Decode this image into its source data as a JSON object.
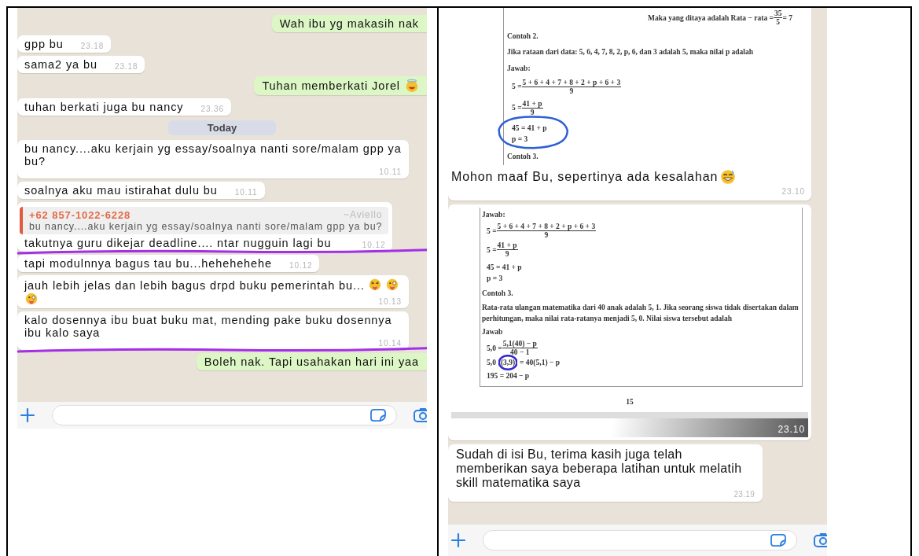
{
  "chats": [
    {
      "messages": [
        {
          "kind": "out",
          "text": "Wah ibu yg makasih nak"
        },
        {
          "kind": "in",
          "text": "gpp bu",
          "time": "23.18",
          "underlined": false
        },
        {
          "kind": "in",
          "text": "sama2 ya bu",
          "time": "23.18",
          "underlined": false
        },
        {
          "kind": "out",
          "text": "Tuhan memberkati Jorel",
          "emoji": [
            {
              "kind": "angel"
            }
          ]
        },
        {
          "kind": "in",
          "text": "tuhan berkati juga bu nancy",
          "time": "23.36",
          "underlined": false
        },
        {
          "kind": "date",
          "text": "Today"
        },
        {
          "kind": "in",
          "text": "bu nancy....aku kerjain yg essay/soalnya nanti sore/malam gpp ya bu?",
          "time": "10.11",
          "underlined": false
        },
        {
          "kind": "in",
          "text": "soalnya aku mau istirahat dulu bu",
          "time": "10.11",
          "underlined": false
        },
        {
          "kind": "quote",
          "quote": {
            "name": "+62 857-1022-6228",
            "author": "~Aviello",
            "text": "bu nancy....aku kerjain yg essay/soalnya nanti sore/malam gpp ya bu?"
          },
          "text": "takutnya guru dikejar deadline.... ntar nugguin lagi bu",
          "time": "10.12",
          "underlined": true
        },
        {
          "kind": "in",
          "text": "tapi modulnnya bagus tau bu...hehehehehe",
          "time": "10.12",
          "underlined": false
        },
        {
          "kind": "in",
          "text": "jauh lebih jelas dan lebih bagus drpd buku pemerintah bu...",
          "emoji": [
            {
              "kind": "tongue"
            },
            {
              "kind": "wink"
            },
            {
              "kind": "wink"
            }
          ],
          "time": "10.13",
          "underlined": false
        },
        {
          "kind": "in",
          "text": "kalo dosennya ibu buat buku mat, mending pake buku dosennya ibu kalo saya",
          "time": "10.14",
          "underlined": true
        },
        {
          "kind": "out",
          "text": "Boleh nak. Tapi usahakan hari ini yaa"
        }
      ]
    },
    {
      "messages": [
        {
          "kind": "image",
          "doc": {
            "kind": "ruled",
            "lines": [
              {
                "kind": "frac-right",
                "lhs": "Maka yang ditaya adalah Rata − rata = ",
                "num": "35",
                "den": "5",
                "rhs": " = 7"
              },
              {
                "kind": "text",
                "text": "Contoh 2."
              },
              {
                "kind": "text",
                "text": "Jika rataan dari data: 5, 6, 4, 7, 8, 2, p, 6, dan 3 adalah 5, maka nilai p adalah"
              },
              {
                "kind": "text",
                "text": "Jawab:"
              },
              {
                "kind": "frac",
                "lhs": "5 = ",
                "num": "5 + 6 + 4 + 7 + 8 + 2 + p + 6 + 3",
                "den": "9"
              },
              {
                "kind": "frac",
                "lhs": "5 = ",
                "num": "41 + p",
                "den": "9"
              },
              {
                "kind": "eqs",
                "circled": true,
                "items": [
                  "45 = 41 + p",
                  "p = 3"
                ]
              },
              {
                "kind": "text",
                "text": "Contoh 3."
              }
            ]
          },
          "caption": "Mohon maaf Bu, sepertinya ada kesalahan",
          "emoji": [
            {
              "kind": "sweat"
            }
          ],
          "time": "23.10"
        },
        {
          "kind": "image",
          "doc": {
            "kind": "boxed",
            "lines": [
              {
                "kind": "text",
                "text": "Jawab:"
              },
              {
                "kind": "frac",
                "lhs": "5 = ",
                "num": "5 + 6 + 4 + 7 + 8 + 2 + p + 6 + 3",
                "den": "9"
              },
              {
                "kind": "frac",
                "lhs": "5 = ",
                "num": "41 + p",
                "den": "9"
              },
              {
                "kind": "eqs",
                "circled": false,
                "items": [
                  "45 = 41 + p",
                  "p = 3"
                ]
              },
              {
                "kind": "text",
                "text": "Contoh 3."
              },
              {
                "kind": "text",
                "text": "Rata-rata ulangan matematika dari 40 anak adalah 5, 1. Jika seorang siswa tidak disertakan dalam perhitungan, maka nilai rata-ratanya menjadi 5, 0. Nilai siswa tersebut adalah"
              },
              {
                "kind": "text",
                "text": "Jawab"
              },
              {
                "kind": "frac",
                "lhs": "5,0 = ",
                "num": "5,1(40) − p",
                "den": "40 − 1"
              },
              {
                "kind": "segments",
                "segments": [
                  {
                    "text": "5,0",
                    "circled": false
                  },
                  {
                    "text": "(3,9)",
                    "circled": true
                  },
                  {
                    "text": "= 40(5,1) − p",
                    "circled": false
                  }
                ]
              },
              {
                "kind": "eqs",
                "circled": false,
                "items": [
                  "195 = 204 − p"
                ]
              }
            ],
            "page": "15"
          },
          "time": "23.10"
        },
        {
          "kind": "in",
          "text": "Sudah di isi Bu, terima kasih juga telah memberikan saya beberapa latihan untuk melatih skill matematika saya",
          "time": "23.19",
          "underlined": false
        }
      ]
    }
  ]
}
